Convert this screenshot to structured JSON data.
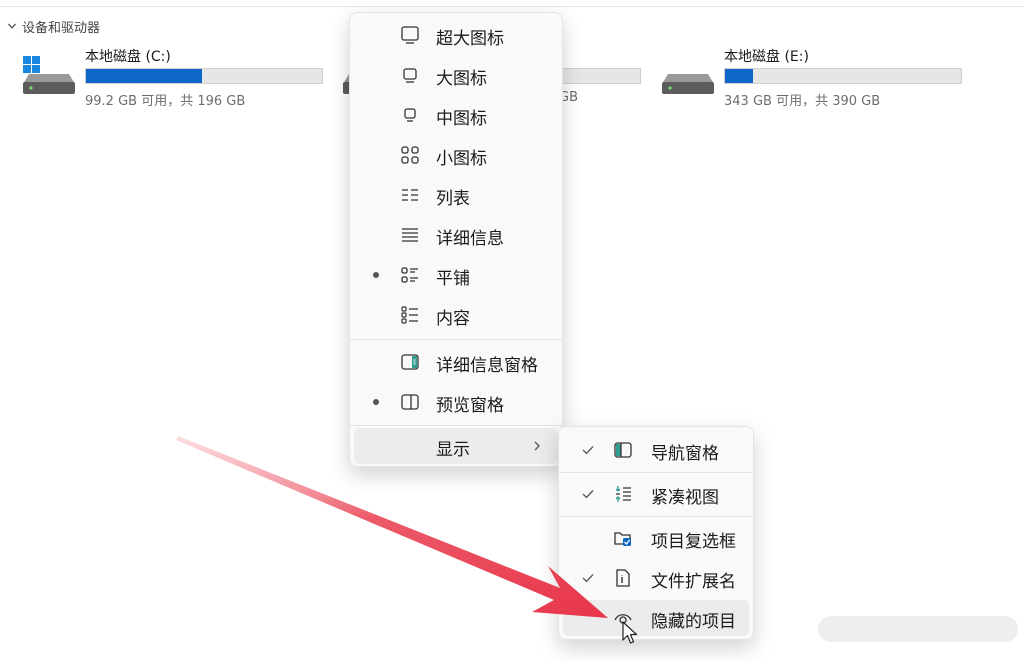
{
  "section": {
    "title": "设备和驱动器",
    "chevron_icon": "chevron-down-icon"
  },
  "drives": [
    {
      "label": "本地磁盘 (C:)",
      "free_text": "99.2 GB 可用，共 196 GB",
      "used_fraction": 0.49,
      "icon": "windows-drive-icon"
    },
    {
      "label": "",
      "free_text": "GB",
      "used_fraction": 0.5,
      "icon": "hard-drive-icon"
    },
    {
      "label": "本地磁盘 (E:)",
      "free_text": "343 GB 可用，共 390 GB",
      "used_fraction": 0.12,
      "icon": "hard-drive-icon"
    }
  ],
  "colors": {
    "accent": "#0c67c7",
    "arrow": "#e8475c",
    "menu_bg": "#f9f9f9"
  },
  "view_menu": {
    "items": [
      {
        "label": "超大图标",
        "icon": "extra-large-icons-icon",
        "selected": false
      },
      {
        "label": "大图标",
        "icon": "large-icons-icon",
        "selected": false
      },
      {
        "label": "中图标",
        "icon": "medium-icons-icon",
        "selected": false
      },
      {
        "label": "小图标",
        "icon": "small-icons-icon",
        "selected": false
      },
      {
        "label": "列表",
        "icon": "list-icon",
        "selected": false
      },
      {
        "label": "详细信息",
        "icon": "details-icon",
        "selected": false
      },
      {
        "label": "平铺",
        "icon": "tiles-icon",
        "selected": true
      },
      {
        "label": "内容",
        "icon": "content-icon",
        "selected": false
      }
    ],
    "panes": [
      {
        "label": "详细信息窗格",
        "icon": "details-pane-icon",
        "selected": false
      },
      {
        "label": "预览窗格",
        "icon": "preview-pane-icon",
        "selected": true
      }
    ],
    "show": {
      "label": "显示",
      "icon": "chevron-right-icon"
    }
  },
  "show_submenu": {
    "items": [
      {
        "label": "导航窗格",
        "icon": "navigation-pane-icon",
        "checked": true
      },
      {
        "label": "紧凑视图",
        "icon": "compact-view-icon",
        "checked": true
      },
      {
        "label": "项目复选框",
        "icon": "item-checkbox-icon",
        "checked": false
      },
      {
        "label": "文件扩展名",
        "icon": "file-extension-icon",
        "checked": true
      },
      {
        "label": "隐藏的项目",
        "icon": "hidden-items-icon",
        "checked": false
      }
    ]
  }
}
